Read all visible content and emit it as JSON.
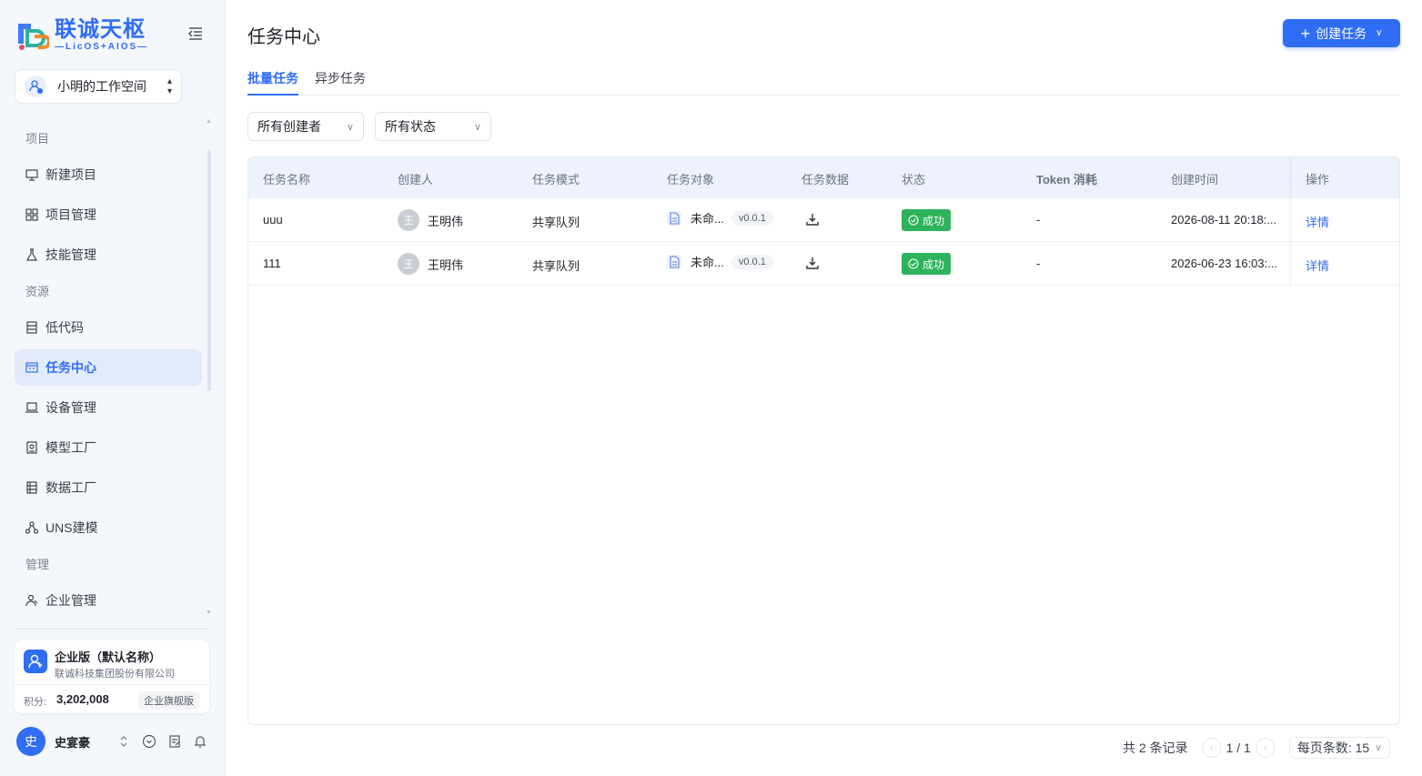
{
  "brand": {
    "title": "联诚天枢",
    "subtitle": "—LicOS+AIOS—"
  },
  "workspace": {
    "label": "小明的工作空间"
  },
  "nav": {
    "groups": [
      {
        "label": "项目",
        "items": [
          {
            "label": "新建项目",
            "icon": "monitor-icon"
          },
          {
            "label": "项目管理",
            "icon": "grid-icon"
          },
          {
            "label": "技能管理",
            "icon": "flask-icon"
          }
        ]
      },
      {
        "label": "资源",
        "items": [
          {
            "label": "低代码",
            "icon": "doc-icon"
          },
          {
            "label": "任务中心",
            "icon": "calendar-icon",
            "active": true
          },
          {
            "label": "设备管理",
            "icon": "laptop-icon"
          },
          {
            "label": "模型工厂",
            "icon": "model-icon"
          },
          {
            "label": "数据工厂",
            "icon": "database-icon"
          },
          {
            "label": "UNS建模",
            "icon": "network-icon"
          }
        ]
      },
      {
        "label": "管理",
        "items": [
          {
            "label": "企业管理",
            "icon": "users-icon"
          }
        ]
      }
    ]
  },
  "org": {
    "name": "企业版（默认名称）",
    "company": "联诚科技集团股份有限公司",
    "points_label": "积分:",
    "points": "3,202,008",
    "plan": "企业旗舰版"
  },
  "user": {
    "avatar": "史",
    "name": "史宴豪"
  },
  "page": {
    "title": "任务中心",
    "create_label": "创建任务"
  },
  "tabs": [
    {
      "label": "批量任务",
      "active": true
    },
    {
      "label": "异步任务",
      "active": false
    }
  ],
  "filters": [
    {
      "label": "所有创建者"
    },
    {
      "label": "所有状态"
    }
  ],
  "table": {
    "columns": [
      "任务名称",
      "创建人",
      "任务模式",
      "任务对象",
      "任务数据",
      "状态",
      "Token 消耗",
      "创建时间",
      "操作"
    ],
    "rows": [
      {
        "name": "uuu",
        "creator_avatar": "王",
        "creator": "王明伟",
        "mode": "共享队列",
        "object": "未命...",
        "version": "v0.0.1",
        "status": "成功",
        "token": "-",
        "created": "2026-08-11 20:18:...",
        "action": "详情"
      },
      {
        "name": "111",
        "creator_avatar": "王",
        "creator": "王明伟",
        "mode": "共享队列",
        "object": "未命...",
        "version": "v0.0.1",
        "status": "成功",
        "token": "-",
        "created": "2026-06-23 16:03:...",
        "action": "详情"
      }
    ]
  },
  "pagination": {
    "total": "共 2 条记录",
    "page": "1 / 1",
    "page_size": "每页条数: 15"
  },
  "colors": {
    "primary": "#2f6df5",
    "success": "#2fb35a",
    "sidebar_bg": "#f4f7fc"
  }
}
